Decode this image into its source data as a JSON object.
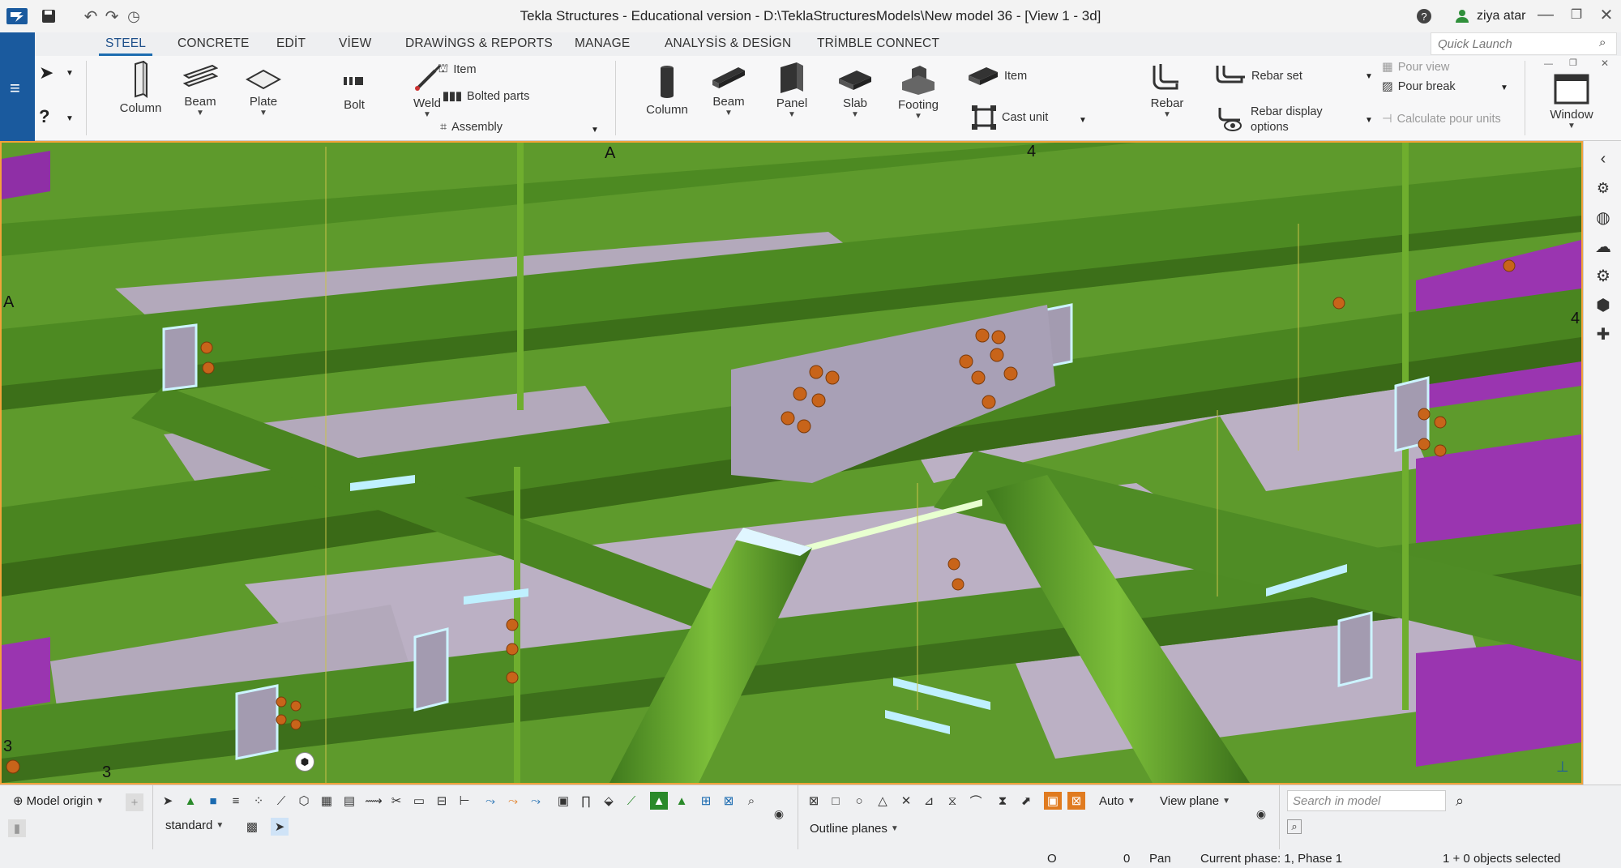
{
  "window": {
    "title": "Tekla Structures - Educational version - D:\\TeklaStructuresModels\\New model 36  - [View 1 - 3d]",
    "user": "ziya atar"
  },
  "tabs": [
    "STEEL",
    "CONCRETE",
    "EDİT",
    "VİEW",
    "DRAWİNGS & REPORTS",
    "MANAGE",
    "ANALYSİS & DESİGN",
    "TRİMBLE CONNECT"
  ],
  "quick_launch": {
    "placeholder": "Quick Launch"
  },
  "ribbon": {
    "steel": {
      "column": "Column",
      "beam": "Beam",
      "plate": "Plate",
      "bolt": "Bolt",
      "weld": "Weld",
      "item": "Item",
      "bolted_parts": "Bolted parts",
      "assembly": "Assembly"
    },
    "concrete": {
      "column": "Column",
      "beam": "Beam",
      "panel": "Panel",
      "slab": "Slab",
      "footing": "Footing",
      "item": "Item",
      "cast_unit": "Cast unit",
      "rebar": "Rebar",
      "rebar_set": "Rebar set",
      "rebar_display_1": "Rebar display",
      "rebar_display_2": "options",
      "pour_view": "Pour view",
      "pour_break": "Pour break",
      "calc_pour": "Calculate pour units"
    },
    "window": "Window"
  },
  "viewport": {
    "grid_labels": {
      "a_top": "A",
      "four_top": "4",
      "a_left": "A",
      "four_right": "4",
      "three_left": "3",
      "three_bottom": "3"
    }
  },
  "bottom": {
    "model_origin": "Model origin",
    "standard": "standard",
    "auto": "Auto",
    "view_plane": "View plane",
    "outline_planes": "Outline planes",
    "search_placeholder": "Search in model"
  },
  "status": {
    "o": "O",
    "zero": "0",
    "mode": "Pan",
    "phase": "Current phase: 1, Phase 1",
    "selection": "1 + 0 objects selected"
  },
  "colors": {
    "model_green": "#5e9a2c",
    "accent": "#1a5a9e",
    "viewport_border": "#f2a23a"
  }
}
